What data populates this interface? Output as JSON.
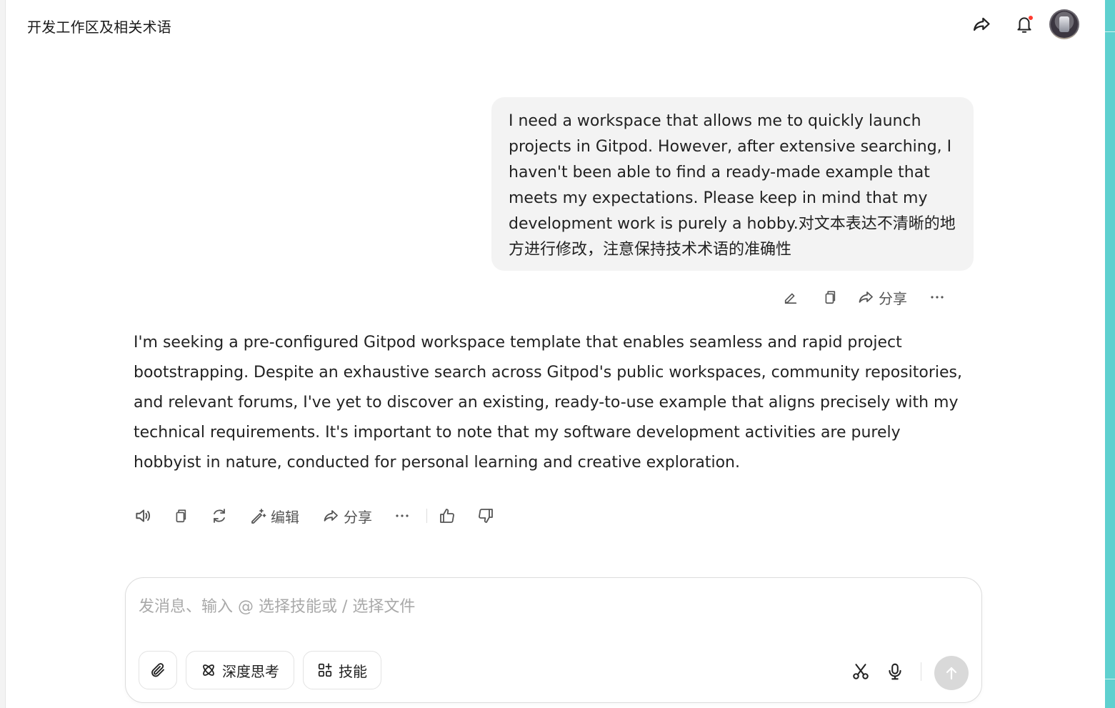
{
  "header": {
    "title": "开发工作区及相关术语"
  },
  "conversation": {
    "user_message": "I need a workspace that allows me to quickly launch projects in Gitpod. However, after extensive searching, I haven't been able to find a ready-made example that meets my expectations. Please keep in mind that my development work is purely a hobby.对文本表达不清晰的地方进行修改，注意保持技术术语的准确性",
    "user_actions": {
      "share_label": "分享"
    },
    "assistant_message": "I'm seeking a pre-configured Gitpod workspace template that enables seamless and rapid project bootstrapping. Despite an exhaustive search across Gitpod's public workspaces, community repositories, and relevant forums, I've yet to discover an existing, ready-to-use example that aligns precisely with my technical requirements. It's important to note that my software development activities are purely hobbyist in nature, conducted for personal learning and creative exploration.",
    "assistant_actions": {
      "edit_label": "编辑",
      "share_label": "分享"
    }
  },
  "composer": {
    "placeholder": "发消息、输入 @ 选择技能或 / 选择文件",
    "value": "",
    "deep_think_label": "深度思考",
    "skills_label": "技能"
  },
  "colors": {
    "accent_strip": "#5fd0cf",
    "notification_dot": "#ff3b30",
    "bubble_bg": "#f3f3f3",
    "send_disabled": "#d9d9d9"
  }
}
